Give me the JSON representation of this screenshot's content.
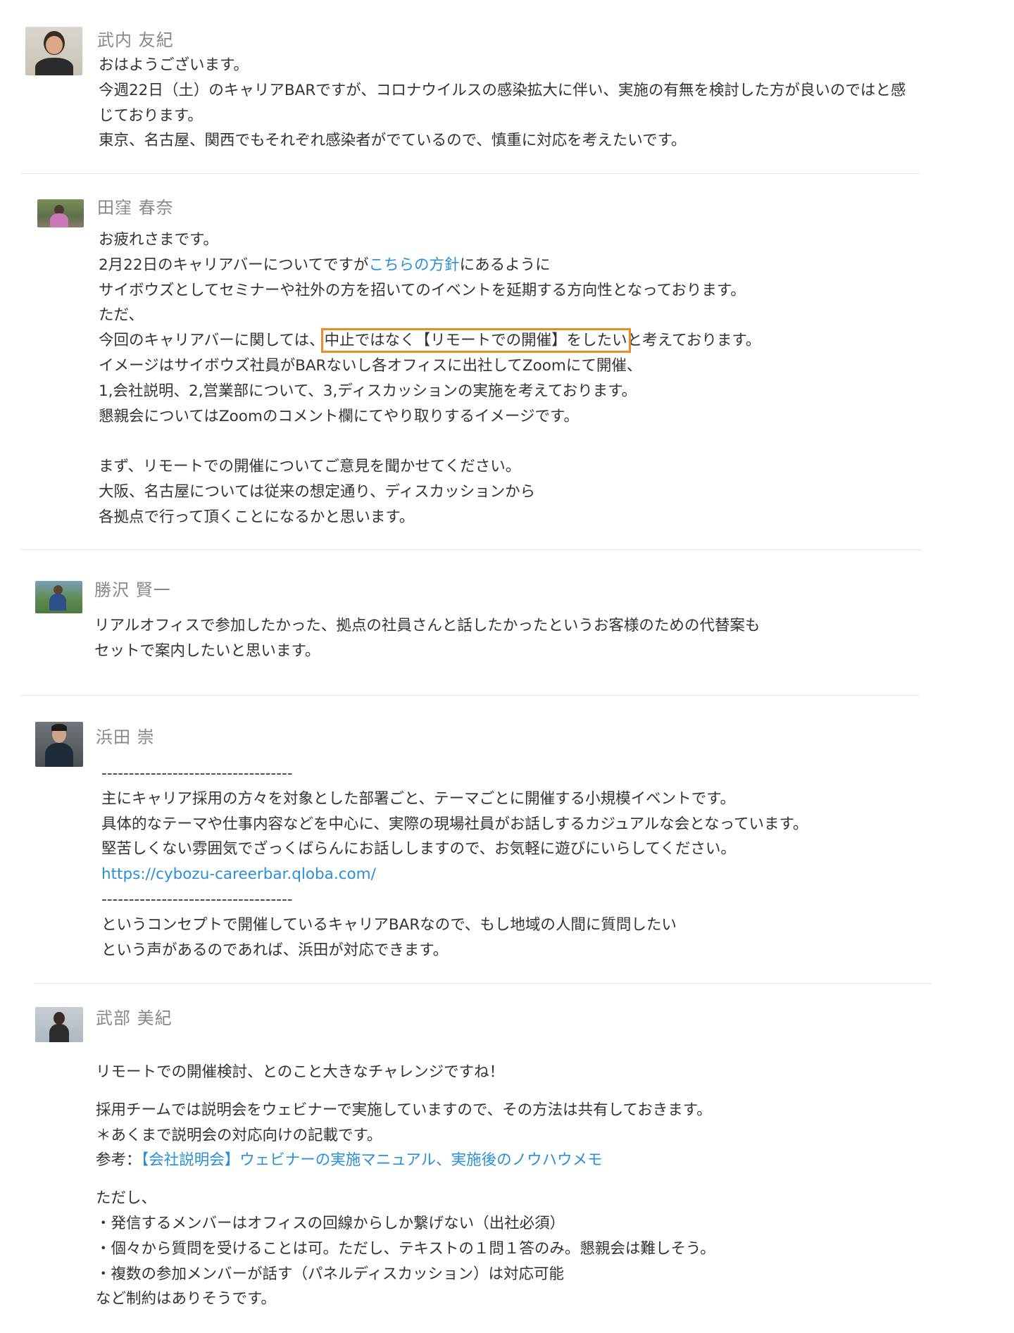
{
  "posts": [
    {
      "author": "武内 友紀",
      "avatar_icon": "user-avatar-icon",
      "lines": [
        "おはようございます。",
        "今週22日（土）のキャリアBARですが、コロナウイルスの感染拡大に伴い、実施の有無を検討した方が良いのではと感",
        "じております。",
        "東京、名古屋、関西でもそれぞれ感染者がでているので、慎重に対応を考えたいです。"
      ]
    },
    {
      "author": "田窪 春奈",
      "avatar_icon": "user-avatar-icon",
      "line0": "お疲れさまです。",
      "line1_pre": "2月22日のキャリアバーについてですが",
      "line1_link": "こちらの方針",
      "line1_post": "にあるように",
      "line2": "サイボウズとしてセミナーや社外の方を招いてのイベントを延期する方向性となっております。",
      "line3": "ただ、",
      "line4_pre": "今回のキャリアバーに関しては、",
      "line4_hl": "中止ではなく【リモートでの開催】をしたい",
      "line4_post": "と考えております。",
      "line5": "イメージはサイボウズ社員がBARないし各オフィスに出社してZoomにて開催、",
      "line6": "1,会社説明、2,営業部について、3,ディスカッションの実施を考えております。",
      "line7": "懇親会についてはZoomのコメント欄にてやり取りするイメージです。",
      "line8": "まず、リモートでの開催についてご意見を聞かせてください。",
      "line9": "大阪、名古屋については従来の想定通り、ディスカッションから",
      "line10": "各拠点で行って頂くことになるかと思います。"
    },
    {
      "author": "勝沢 賢一",
      "avatar_icon": "user-avatar-icon",
      "lines": [
        "リアルオフィスで参加したかった、拠点の社員さんと話したかったというお客様のための代替案も",
        "セットで案内したいと思います。"
      ]
    },
    {
      "author": "浜田 崇",
      "avatar_icon": "user-avatar-icon",
      "rule": "-----------------------------------",
      "line1": "主にキャリア採用の方々を対象とした部署ごと、テーマごとに開催する小規模イベントです。",
      "line2": "具体的なテーマや仕事内容などを中心に、実際の現場社員がお話しするカジュアルな会となっています。",
      "line3": "堅苦しくない雰囲気でざっくばらんにお話ししますので、お気軽に遊びにいらしてください。",
      "url": "https://cybozu-careerbar.qloba.com/",
      "rule2": "-----------------------------------",
      "line4": "というコンセプトで開催しているキャリアBARなので、もし地域の人間に質問したい",
      "line5": "という声があるのであれば、浜田が対応できます。"
    },
    {
      "author": "武部 美紀",
      "avatar_icon": "user-avatar-icon",
      "line1": "リモートでの開催検討、とのこと大きなチャレンジですね！",
      "line2": "採用チームでは説明会をウェビナーで実施していますので、その方法は共有しておきます。",
      "line3": "＊あくまで説明会の対応向けの記載です。",
      "ref_label": "参考：",
      "ref_link": "【会社説明会】ウェビナーの実施マニュアル、実施後のノウハウメモ",
      "line4": "ただし、",
      "line5": "・発信するメンバーはオフィスの回線からしか繋げない（出社必須）",
      "line6": "・個々から質問を受けることは可。ただし、テキストの１問１答のみ。懇親会は難しそう。",
      "line7": "・複数の参加メンバーが話す（パネルディスカッション）は対応可能",
      "line8": "など制約はありそうです。"
    }
  ],
  "colors": {
    "link": "#2a8fd6",
    "highlight_border": "#f08a24",
    "author_name": "#888888",
    "text": "#333333",
    "divider": "#e3e3e3"
  }
}
